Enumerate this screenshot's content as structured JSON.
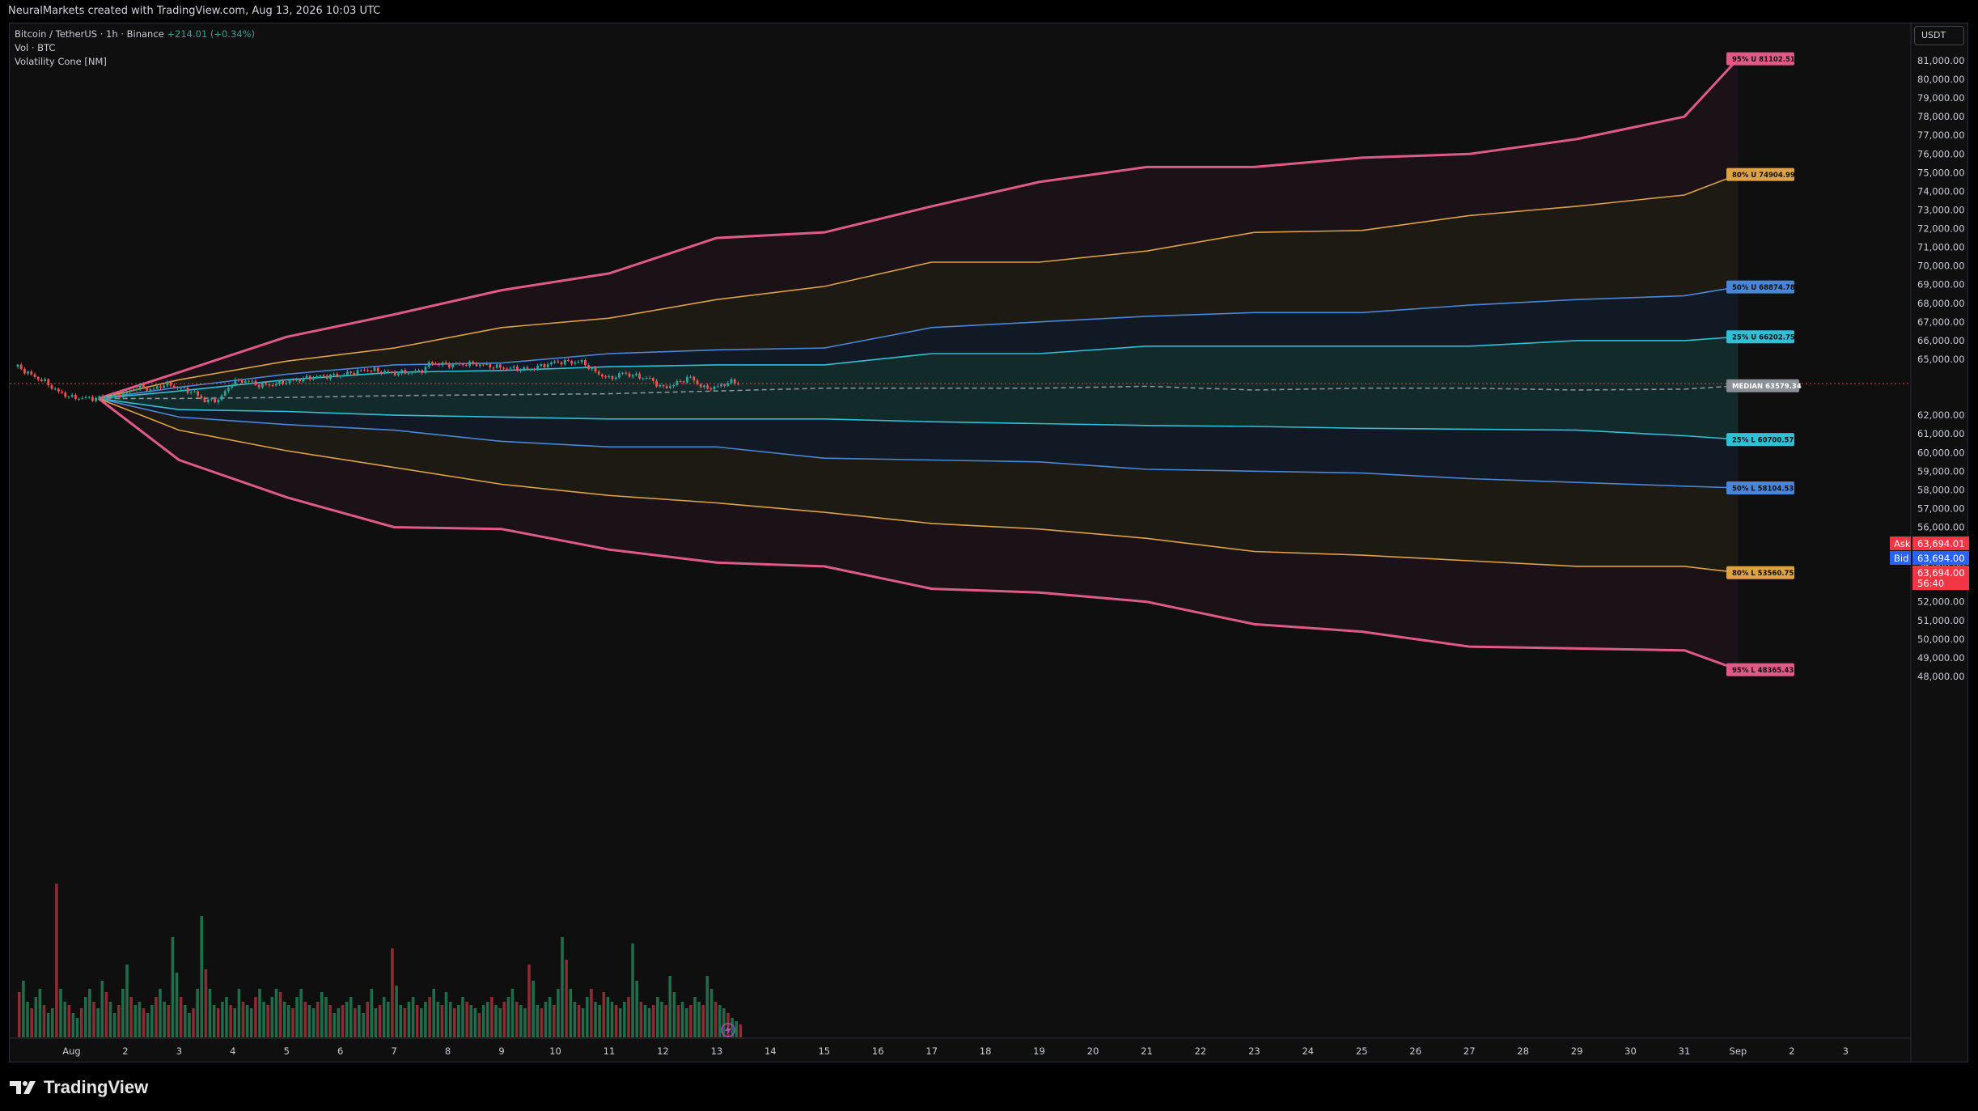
{
  "header": {
    "attribution": "NeuralMarkets created with TradingView.com, Aug 13, 2026 10:03 UTC"
  },
  "legend": {
    "symbol": "Bitcoin / TetherUS · 1h · Binance",
    "change": "+214.01 (+0.34%)",
    "volume": "Vol · BTC",
    "indicator": "Volatility Cone [NM]"
  },
  "axis": {
    "currency_button": "USDT",
    "x_ticks": [
      "Aug",
      "2",
      "3",
      "4",
      "5",
      "6",
      "7",
      "8",
      "9",
      "10",
      "11",
      "12",
      "13",
      "14",
      "15",
      "16",
      "17",
      "18",
      "19",
      "20",
      "21",
      "22",
      "23",
      "24",
      "25",
      "26",
      "27",
      "28",
      "29",
      "30",
      "31",
      "Sep",
      "2",
      "3"
    ],
    "y_ticks": [
      "81,000.00",
      "80,000.00",
      "79,000.00",
      "78,000.00",
      "77,000.00",
      "76,000.00",
      "75,000.00",
      "74,000.00",
      "73,000.00",
      "72,000.00",
      "71,000.00",
      "70,000.00",
      "69,000.00",
      "68,000.00",
      "67,000.00",
      "66,000.00",
      "65,000.00",
      "62,000.00",
      "61,000.00",
      "60,000.00",
      "59,000.00",
      "58,000.00",
      "57,000.00",
      "56,000.00",
      "55,000.00",
      "54,000.00",
      "53,000.00",
      "52,000.00",
      "51,000.00",
      "50,000.00",
      "49,000.00",
      "48,000.00"
    ]
  },
  "price_tags": {
    "ask_label": "Ask",
    "ask_value": "63,694.01",
    "bid_label": "Bid",
    "bid_value": "63,694.00",
    "last_value": "63,694.00",
    "countdown": "56:40"
  },
  "footer": {
    "logo_text": "TradingView"
  },
  "colors": {
    "p95": "#e05a88",
    "p80": "#dfa145",
    "p50": "#4a86d8",
    "p25": "#2fc0d6",
    "median": "#8a8f98",
    "up": "#26a69a",
    "down": "#ef5350",
    "ask": "#f23645",
    "bid": "#2962ff"
  },
  "chart_data": {
    "type": "line",
    "title": "Volatility Cone [NM]",
    "x_unit": "date",
    "origin": {
      "date": "2026-08-01T12:00",
      "price": 62900
    },
    "ylim": [
      48000,
      81000
    ],
    "xlim": [
      "2026-07-31T00:00",
      "2026-09-03T00:00"
    ],
    "x_dates": [
      "08-03",
      "08-05",
      "08-07",
      "08-09",
      "08-11",
      "08-13",
      "08-15",
      "08-17",
      "08-19",
      "08-21",
      "08-23",
      "08-25",
      "08-27",
      "08-29",
      "08-31",
      "09-01"
    ],
    "series": [
      {
        "name": "95% U",
        "label": "95% U  81102.51",
        "color_key": "p95",
        "values": [
          64300,
          66200,
          67400,
          68700,
          69600,
          71500,
          71800,
          73200,
          74500,
          75300,
          75300,
          75800,
          76000,
          76800,
          78000,
          81102.51
        ]
      },
      {
        "name": "80% U",
        "label": "80% U  74904.99",
        "color_key": "p80",
        "values": [
          63900,
          64900,
          65600,
          66700,
          67200,
          68200,
          68900,
          70200,
          70200,
          70800,
          71800,
          71900,
          72700,
          73200,
          73800,
          74904.99
        ]
      },
      {
        "name": "50% U",
        "label": "50% U  68874.78",
        "color_key": "p50",
        "values": [
          63500,
          64200,
          64700,
          64800,
          65300,
          65500,
          65600,
          66700,
          67000,
          67300,
          67500,
          67500,
          67900,
          68200,
          68400,
          68874.78
        ]
      },
      {
        "name": "25% U",
        "label": "25% U  66202.75",
        "color_key": "p25",
        "values": [
          63300,
          63900,
          64300,
          64400,
          64600,
          64700,
          64700,
          65300,
          65300,
          65700,
          65700,
          65700,
          65700,
          66000,
          66000,
          66202.75
        ]
      },
      {
        "name": "MEDIAN",
        "label": "MEDIAN  63579.34",
        "color_key": "median",
        "values": [
          62900,
          62950,
          63050,
          63100,
          63150,
          63300,
          63450,
          63450,
          63450,
          63550,
          63350,
          63450,
          63450,
          63350,
          63400,
          63579.34
        ]
      },
      {
        "name": "25% L",
        "label": "25% L  60700.57",
        "color_key": "p25",
        "values": [
          62300,
          62200,
          62000,
          61900,
          61800,
          61800,
          61800,
          61650,
          61550,
          61450,
          61400,
          61300,
          61250,
          61200,
          60900,
          60700.57
        ]
      },
      {
        "name": "50% L",
        "label": "50% L  58104.53",
        "color_key": "p50",
        "values": [
          61900,
          61500,
          61200,
          60600,
          60300,
          60300,
          59700,
          59600,
          59500,
          59100,
          59000,
          58900,
          58600,
          58400,
          58200,
          58104.53
        ]
      },
      {
        "name": "80% L",
        "label": "80% L  53560.75",
        "color_key": "p80",
        "values": [
          61200,
          60100,
          59200,
          58300,
          57700,
          57300,
          56800,
          56200,
          55900,
          55400,
          54700,
          54500,
          54200,
          53900,
          53900,
          53560.75
        ]
      },
      {
        "name": "95% L",
        "label": "95% L  48365.43",
        "color_key": "p95",
        "values": [
          59600,
          57600,
          56000,
          55900,
          54800,
          54100,
          53900,
          52700,
          52500,
          52000,
          50800,
          50400,
          49600,
          49500,
          49400,
          48365.43
        ]
      }
    ],
    "price_path": {
      "name": "BTCUSDT 1h",
      "points": [
        [
          "07-31T00",
          64600
        ],
        [
          "07-31T06",
          64150
        ],
        [
          "07-31T12",
          63800
        ],
        [
          "07-31T18",
          63250
        ],
        [
          "08-01T00",
          62950
        ],
        [
          "08-01T12",
          62900
        ],
        [
          "08-02T00",
          63150
        ],
        [
          "08-02T06",
          63550
        ],
        [
          "08-02T12",
          63350
        ],
        [
          "08-02T18",
          63700
        ],
        [
          "08-03T00",
          63450
        ],
        [
          "08-03T06",
          63250
        ],
        [
          "08-03T12",
          62750
        ],
        [
          "08-03T18",
          62850
        ],
        [
          "08-04T00",
          63800
        ],
        [
          "08-04T06",
          63850
        ],
        [
          "08-04T12",
          63600
        ],
        [
          "08-04T18",
          63650
        ],
        [
          "08-05T00",
          63800
        ],
        [
          "08-05T12",
          64050
        ],
        [
          "08-06T00",
          64150
        ],
        [
          "08-06T12",
          64450
        ],
        [
          "08-07T00",
          64250
        ],
        [
          "08-07T12",
          64350
        ],
        [
          "08-07T16",
          64800
        ],
        [
          "08-08T00",
          64700
        ],
        [
          "08-08T12",
          64750
        ],
        [
          "08-09T00",
          64550
        ],
        [
          "08-09T12",
          64450
        ],
        [
          "08-10T00",
          64850
        ],
        [
          "08-10T12",
          64850
        ],
        [
          "08-10T18",
          64300
        ],
        [
          "08-11T00",
          63950
        ],
        [
          "08-11T06",
          64250
        ],
        [
          "08-11T12",
          64100
        ],
        [
          "08-11T18",
          63950
        ],
        [
          "08-12T00",
          63450
        ],
        [
          "08-12T06",
          63700
        ],
        [
          "08-12T12",
          64050
        ],
        [
          "08-12T18",
          63450
        ],
        [
          "08-13T00",
          63500
        ],
        [
          "08-13T06",
          63800
        ],
        [
          "08-13T10",
          63694
        ]
      ]
    },
    "volume_series": "Vol · BTC (hourly bars, relative heights)",
    "volume_profile": [
      0.28,
      0.35,
      0.22,
      0.18,
      0.25,
      0.3,
      0.2,
      0.15,
      0.18,
      0.95,
      0.3,
      0.22,
      0.2,
      0.15,
      0.12,
      0.18,
      0.25,
      0.3,
      0.22,
      0.18,
      0.35,
      0.28,
      0.22,
      0.15,
      0.2,
      0.3,
      0.45,
      0.25,
      0.2,
      0.22,
      0.18,
      0.15,
      0.2,
      0.25,
      0.3,
      0.22,
      0.2,
      0.62,
      0.4,
      0.25,
      0.2,
      0.15,
      0.18,
      0.3,
      0.75,
      0.42,
      0.3,
      0.2,
      0.18,
      0.22,
      0.25,
      0.2,
      0.18,
      0.3,
      0.22,
      0.2,
      0.18,
      0.25,
      0.3,
      0.22,
      0.2,
      0.25,
      0.3,
      0.28,
      0.22,
      0.2,
      0.18,
      0.25,
      0.3,
      0.22,
      0.2,
      0.18,
      0.22,
      0.28,
      0.25,
      0.2,
      0.15,
      0.18,
      0.2,
      0.22,
      0.25,
      0.18,
      0.2,
      0.15,
      0.22,
      0.3,
      0.18,
      0.2,
      0.25,
      0.22,
      0.55,
      0.32,
      0.2,
      0.18,
      0.22,
      0.25,
      0.2,
      0.18,
      0.22,
      0.25,
      0.3,
      0.22,
      0.2,
      0.28,
      0.22,
      0.18,
      0.2,
      0.25,
      0.22,
      0.2,
      0.18,
      0.15,
      0.2,
      0.22,
      0.25,
      0.2,
      0.18,
      0.22,
      0.25,
      0.3,
      0.22,
      0.2,
      0.18,
      0.45,
      0.35,
      0.2,
      0.18,
      0.22,
      0.25,
      0.2,
      0.3,
      0.62,
      0.48,
      0.3,
      0.22,
      0.2,
      0.18,
      0.25,
      0.3,
      0.22,
      0.2,
      0.28,
      0.25,
      0.22,
      0.2,
      0.18,
      0.22,
      0.25,
      0.58,
      0.35,
      0.22,
      0.2,
      0.18,
      0.2,
      0.25,
      0.22,
      0.2,
      0.38,
      0.28,
      0.2,
      0.22,
      0.18,
      0.2,
      0.25,
      0.22,
      0.2,
      0.38,
      0.3,
      0.22,
      0.2,
      0.18,
      0.15,
      0.12,
      0.1,
      0.08
    ]
  }
}
